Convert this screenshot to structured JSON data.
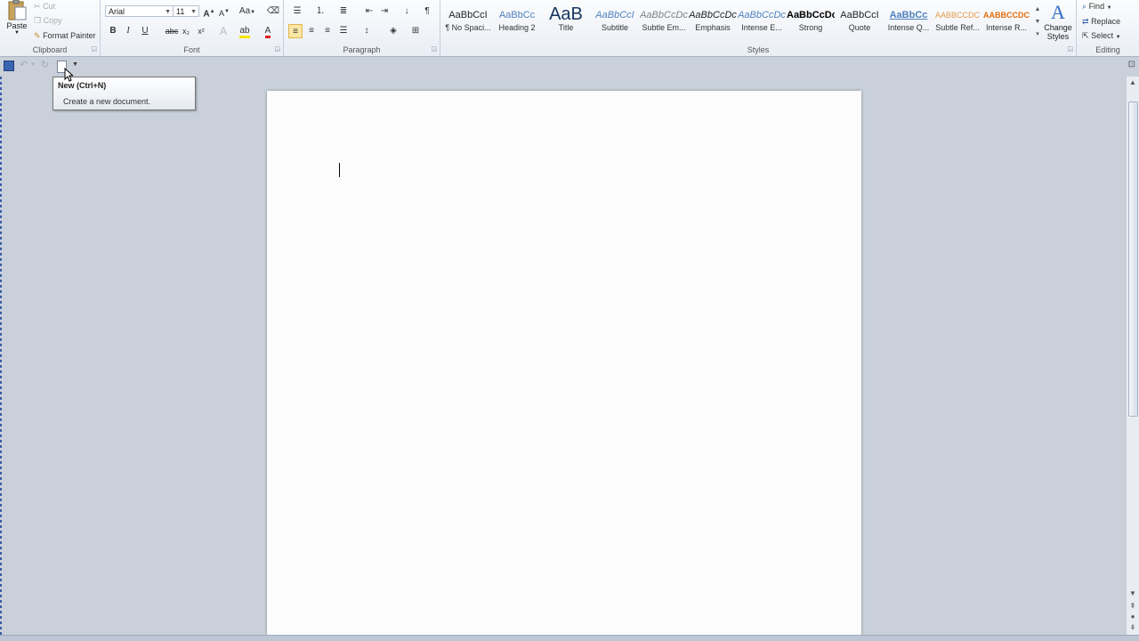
{
  "clipboard": {
    "paste_label": "Paste",
    "cut_label": "Cut",
    "copy_label": "Copy",
    "format_painter_label": "Format Painter",
    "group_label": "Clipboard"
  },
  "font": {
    "family": "Arial",
    "size": "11",
    "group_label": "Font",
    "grow_label": "A",
    "shrink_label": "A",
    "case_label": "Aa",
    "bold_label": "B",
    "italic_label": "I",
    "underline_label": "U",
    "strike_label": "abc",
    "subscript_label": "x₂",
    "superscript_label": "x²",
    "text_effects_label": "A",
    "font_color_label": "A"
  },
  "paragraph": {
    "group_label": "Paragraph",
    "pilcrow_label": "¶"
  },
  "styles": {
    "group_label": "Styles",
    "change_styles_label": "Change Styles",
    "items": [
      {
        "sample": "AaBbCcI",
        "name": "¶ No Spaci...",
        "color": "#222222"
      },
      {
        "sample": "AaBbCc",
        "name": "Heading 2",
        "color": "#4f81bd"
      },
      {
        "sample": "AaB",
        "name": "Title",
        "color": "#17365d"
      },
      {
        "sample": "AaBbCcI",
        "name": "Subtitle",
        "color": "#4f81bd"
      },
      {
        "sample": "AaBbCcDc",
        "name": "Subtle Em...",
        "color": "#808080"
      },
      {
        "sample": "AaBbCcDc",
        "name": "Emphasis",
        "color": "#222222"
      },
      {
        "sample": "AaBbCcDc",
        "name": "Intense E...",
        "color": "#4f81bd"
      },
      {
        "sample": "AaBbCcDc",
        "name": "Strong",
        "color": "#000000"
      },
      {
        "sample": "AaBbCcI",
        "name": "Quote",
        "color": "#222222"
      },
      {
        "sample": "AaBbCc",
        "name": "Intense Q...",
        "color": "#4f81bd"
      },
      {
        "sample": "AABBCCDC",
        "name": "Subtle Ref...",
        "color": "#e59a4a"
      },
      {
        "sample": "AABBCCDC",
        "name": "Intense R...",
        "color": "#e36c0a"
      }
    ]
  },
  "editing": {
    "group_label": "Editing",
    "find_label": "Find",
    "replace_label": "Replace",
    "select_label": "Select"
  },
  "tooltip": {
    "title": "New (Ctrl+N)",
    "description": "Create a new document."
  },
  "colors": {
    "accent": "#4f81bd",
    "highlight": "#f7e700",
    "font_color": "#e02020"
  }
}
